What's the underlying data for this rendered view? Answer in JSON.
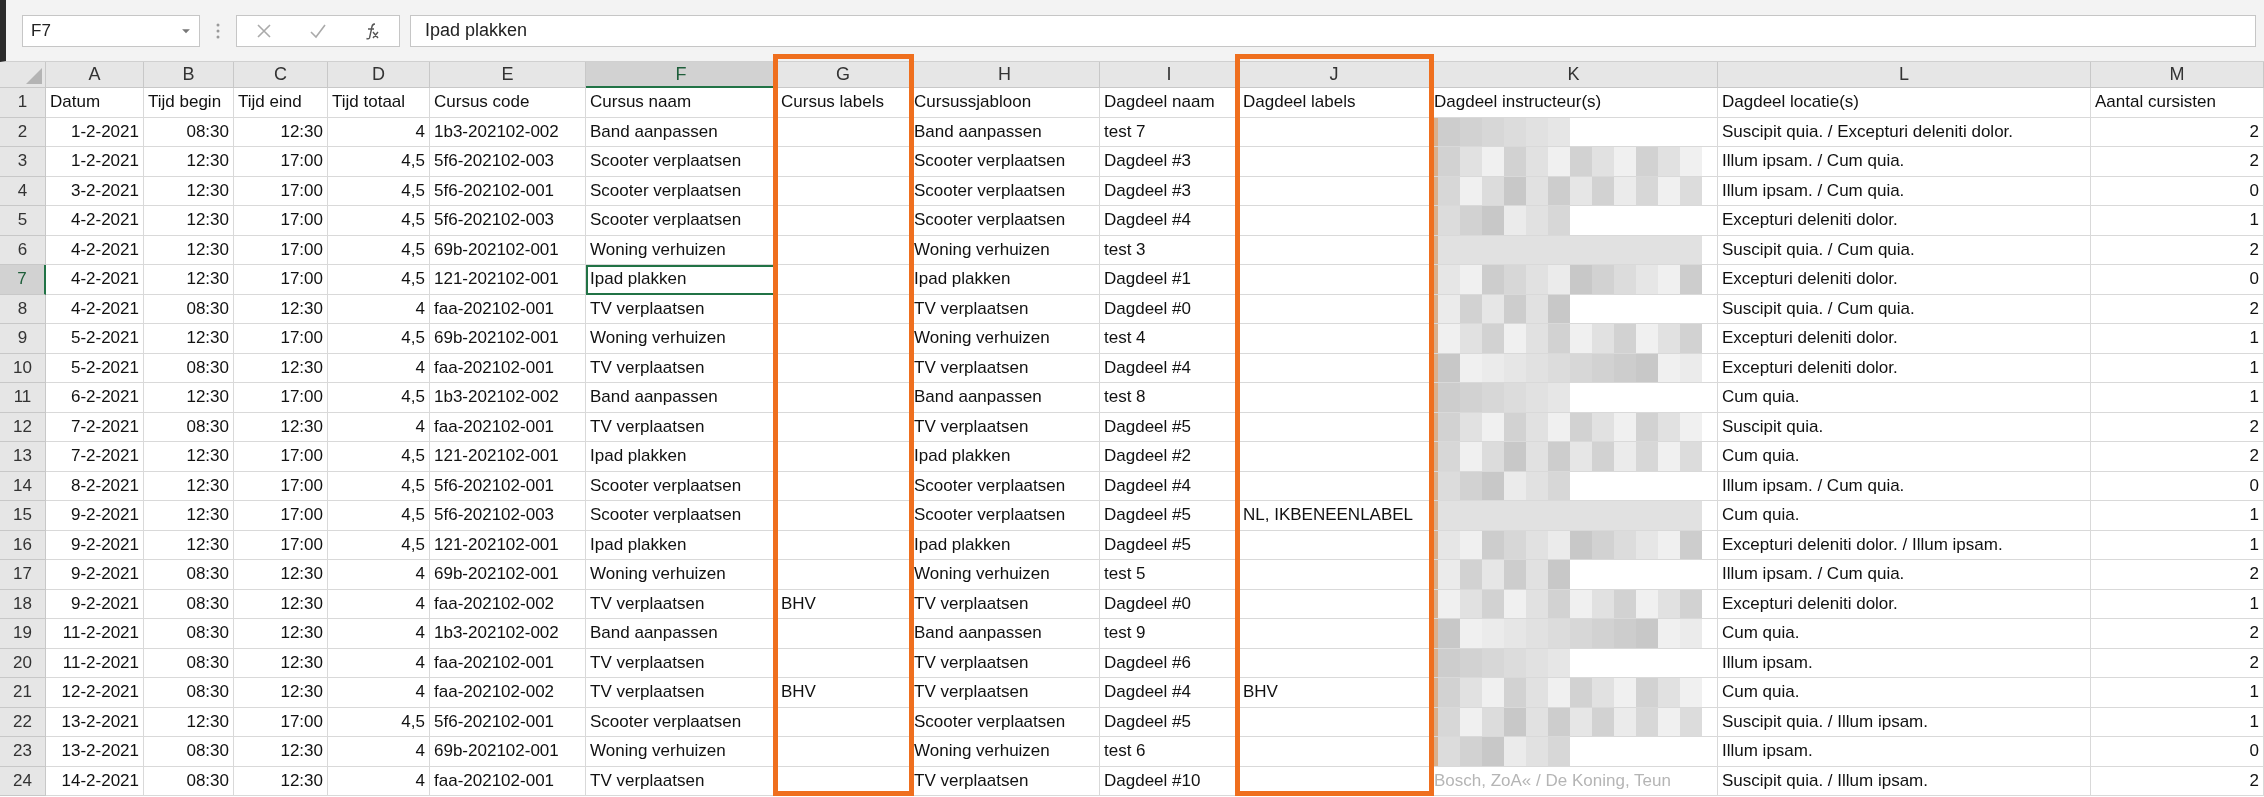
{
  "name_box": {
    "value": "F7"
  },
  "formula_bar": {
    "value": "Ipad plakken"
  },
  "columns": [
    {
      "letter": "A",
      "kind": "number",
      "selected": false,
      "highlighted": false
    },
    {
      "letter": "B",
      "kind": "number",
      "selected": false,
      "highlighted": false
    },
    {
      "letter": "C",
      "kind": "number",
      "selected": false,
      "highlighted": false
    },
    {
      "letter": "D",
      "kind": "number",
      "selected": false,
      "highlighted": false
    },
    {
      "letter": "E",
      "kind": "text",
      "selected": false,
      "highlighted": false
    },
    {
      "letter": "F",
      "kind": "text",
      "selected": true,
      "highlighted": false
    },
    {
      "letter": "G",
      "kind": "text",
      "selected": false,
      "highlighted": true
    },
    {
      "letter": "H",
      "kind": "text",
      "selected": false,
      "highlighted": false
    },
    {
      "letter": "I",
      "kind": "text",
      "selected": false,
      "highlighted": false
    },
    {
      "letter": "J",
      "kind": "text",
      "selected": false,
      "highlighted": true
    },
    {
      "letter": "K",
      "kind": "text",
      "selected": false,
      "highlighted": false
    },
    {
      "letter": "L",
      "kind": "text",
      "selected": false,
      "highlighted": false
    },
    {
      "letter": "M",
      "kind": "number",
      "selected": false,
      "highlighted": false
    }
  ],
  "rows": [
    {
      "number": "1",
      "kind": "header",
      "selected": false,
      "redacted": false,
      "cells": [
        "Datum",
        "Tijd begin",
        "Tijd eind",
        "Tijd totaal",
        "Cursus code",
        "Cursus naam",
        "Cursus labels",
        "Cursussjabloon",
        "Dagdeel naam",
        "Dagdeel labels",
        "Dagdeel instructeur(s)",
        "Dagdeel locatie(s)",
        "Aantal cursisten"
      ]
    },
    {
      "number": "2",
      "kind": "data",
      "selected": false,
      "redacted": true,
      "cells": [
        "1-2-2021",
        "08:30",
        "12:30",
        "4",
        "1b3-202102-002",
        "Band aanpassen",
        null,
        "Band aanpassen",
        "test 7",
        null,
        null,
        "Suscipit quia. / Excepturi deleniti dolor.",
        "2"
      ]
    },
    {
      "number": "3",
      "kind": "data",
      "selected": false,
      "redacted": true,
      "cells": [
        "1-2-2021",
        "12:30",
        "17:00",
        "4,5",
        "5f6-202102-003",
        "Scooter verplaatsen",
        null,
        "Scooter verplaatsen",
        "Dagdeel #3",
        null,
        null,
        "Illum ipsam. / Cum quia.",
        "2"
      ]
    },
    {
      "number": "4",
      "kind": "data",
      "selected": false,
      "redacted": true,
      "cells": [
        "3-2-2021",
        "12:30",
        "17:00",
        "4,5",
        "5f6-202102-001",
        "Scooter verplaatsen",
        null,
        "Scooter verplaatsen",
        "Dagdeel #3",
        null,
        null,
        "Illum ipsam. / Cum quia.",
        "0"
      ]
    },
    {
      "number": "5",
      "kind": "data",
      "selected": false,
      "redacted": true,
      "cells": [
        "4-2-2021",
        "12:30",
        "17:00",
        "4,5",
        "5f6-202102-003",
        "Scooter verplaatsen",
        null,
        "Scooter verplaatsen",
        "Dagdeel #4",
        null,
        null,
        "Excepturi deleniti dolor.",
        "1"
      ]
    },
    {
      "number": "6",
      "kind": "data",
      "selected": false,
      "redacted": true,
      "cells": [
        "4-2-2021",
        "12:30",
        "17:00",
        "4,5",
        "69b-202102-001",
        "Woning verhuizen",
        null,
        "Woning verhuizen",
        "test 3",
        null,
        null,
        "Suscipit quia. / Cum quia.",
        "2"
      ]
    },
    {
      "number": "7",
      "kind": "data",
      "selected": true,
      "redacted": true,
      "cells": [
        "4-2-2021",
        "12:30",
        "17:00",
        "4,5",
        "121-202102-001",
        "Ipad plakken",
        null,
        "Ipad plakken",
        "Dagdeel #1",
        null,
        null,
        "Excepturi deleniti dolor.",
        "0"
      ]
    },
    {
      "number": "8",
      "kind": "data",
      "selected": false,
      "redacted": true,
      "cells": [
        "4-2-2021",
        "08:30",
        "12:30",
        "4",
        "faa-202102-001",
        "TV verplaatsen",
        null,
        "TV verplaatsen",
        "Dagdeel #0",
        null,
        null,
        "Suscipit quia. / Cum quia.",
        "2"
      ]
    },
    {
      "number": "9",
      "kind": "data",
      "selected": false,
      "redacted": true,
      "cells": [
        "5-2-2021",
        "12:30",
        "17:00",
        "4,5",
        "69b-202102-001",
        "Woning verhuizen",
        null,
        "Woning verhuizen",
        "test 4",
        null,
        null,
        "Excepturi deleniti dolor.",
        "1"
      ]
    },
    {
      "number": "10",
      "kind": "data",
      "selected": false,
      "redacted": true,
      "cells": [
        "5-2-2021",
        "08:30",
        "12:30",
        "4",
        "faa-202102-001",
        "TV verplaatsen",
        null,
        "TV verplaatsen",
        "Dagdeel #4",
        null,
        null,
        "Excepturi deleniti dolor.",
        "1"
      ]
    },
    {
      "number": "11",
      "kind": "data",
      "selected": false,
      "redacted": true,
      "cells": [
        "6-2-2021",
        "12:30",
        "17:00",
        "4,5",
        "1b3-202102-002",
        "Band aanpassen",
        null,
        "Band aanpassen",
        "test 8",
        null,
        null,
        "Cum quia.",
        "1"
      ]
    },
    {
      "number": "12",
      "kind": "data",
      "selected": false,
      "redacted": true,
      "cells": [
        "7-2-2021",
        "08:30",
        "12:30",
        "4",
        "faa-202102-001",
        "TV verplaatsen",
        null,
        "TV verplaatsen",
        "Dagdeel #5",
        null,
        null,
        "Suscipit quia.",
        "2"
      ]
    },
    {
      "number": "13",
      "kind": "data",
      "selected": false,
      "redacted": true,
      "cells": [
        "7-2-2021",
        "12:30",
        "17:00",
        "4,5",
        "121-202102-001",
        "Ipad plakken",
        null,
        "Ipad plakken",
        "Dagdeel #2",
        null,
        null,
        "Cum quia.",
        "2"
      ]
    },
    {
      "number": "14",
      "kind": "data",
      "selected": false,
      "redacted": true,
      "cells": [
        "8-2-2021",
        "12:30",
        "17:00",
        "4,5",
        "5f6-202102-001",
        "Scooter verplaatsen",
        null,
        "Scooter verplaatsen",
        "Dagdeel #4",
        null,
        null,
        "Illum ipsam. / Cum quia.",
        "0"
      ]
    },
    {
      "number": "15",
      "kind": "data",
      "selected": false,
      "redacted": true,
      "cells": [
        "9-2-2021",
        "12:30",
        "17:00",
        "4,5",
        "5f6-202102-003",
        "Scooter verplaatsen",
        null,
        "Scooter verplaatsen",
        "Dagdeel #5",
        "NL, IKBENEENLABEL",
        null,
        "Cum quia.",
        "1"
      ]
    },
    {
      "number": "16",
      "kind": "data",
      "selected": false,
      "redacted": true,
      "cells": [
        "9-2-2021",
        "12:30",
        "17:00",
        "4,5",
        "121-202102-001",
        "Ipad plakken",
        null,
        "Ipad plakken",
        "Dagdeel #5",
        null,
        null,
        "Excepturi deleniti dolor. / Illum ipsam.",
        "1"
      ]
    },
    {
      "number": "17",
      "kind": "data",
      "selected": false,
      "redacted": true,
      "cells": [
        "9-2-2021",
        "08:30",
        "12:30",
        "4",
        "69b-202102-001",
        "Woning verhuizen",
        null,
        "Woning verhuizen",
        "test 5",
        null,
        null,
        "Illum ipsam. / Cum quia.",
        "2"
      ]
    },
    {
      "number": "18",
      "kind": "data",
      "selected": false,
      "redacted": true,
      "cells": [
        "9-2-2021",
        "08:30",
        "12:30",
        "4",
        "faa-202102-002",
        "TV verplaatsen",
        "BHV",
        "TV verplaatsen",
        "Dagdeel #0",
        null,
        null,
        "Excepturi deleniti dolor.",
        "1"
      ]
    },
    {
      "number": "19",
      "kind": "data",
      "selected": false,
      "redacted": true,
      "cells": [
        "11-2-2021",
        "08:30",
        "12:30",
        "4",
        "1b3-202102-002",
        "Band aanpassen",
        null,
        "Band aanpassen",
        "test 9",
        null,
        null,
        "Cum quia.",
        "2"
      ]
    },
    {
      "number": "20",
      "kind": "data",
      "selected": false,
      "redacted": true,
      "cells": [
        "11-2-2021",
        "08:30",
        "12:30",
        "4",
        "faa-202102-001",
        "TV verplaatsen",
        null,
        "TV verplaatsen",
        "Dagdeel #6",
        null,
        null,
        "Illum ipsam.",
        "2"
      ]
    },
    {
      "number": "21",
      "kind": "data",
      "selected": false,
      "redacted": true,
      "cells": [
        "12-2-2021",
        "08:30",
        "12:30",
        "4",
        "faa-202102-002",
        "TV verplaatsen",
        "BHV",
        "TV verplaatsen",
        "Dagdeel #4",
        "BHV",
        null,
        "Cum quia.",
        "1"
      ]
    },
    {
      "number": "22",
      "kind": "data",
      "selected": false,
      "redacted": true,
      "cells": [
        "13-2-2021",
        "12:30",
        "17:00",
        "4,5",
        "5f6-202102-001",
        "Scooter verplaatsen",
        null,
        "Scooter verplaatsen",
        "Dagdeel #5",
        null,
        null,
        "Suscipit quia. / Illum ipsam.",
        "1"
      ]
    },
    {
      "number": "23",
      "kind": "data",
      "selected": false,
      "redacted": true,
      "cells": [
        "13-2-2021",
        "08:30",
        "12:30",
        "4",
        "69b-202102-001",
        "Woning verhuizen",
        null,
        "Woning verhuizen",
        "test 6",
        null,
        null,
        "Illum ipsam.",
        "0"
      ]
    },
    {
      "number": "24",
      "kind": "data",
      "selected": false,
      "redacted": false,
      "cells": [
        "14-2-2021",
        "08:30",
        "12:30",
        "4",
        "faa-202102-001",
        "TV verplaatsen",
        null,
        "TV verplaatsen",
        "Dagdeel #10",
        null,
        "Bosch, ZoA« / De Koning, Teun",
        "Suscipit quia. / Illum ipsam.",
        "2"
      ]
    }
  ]
}
